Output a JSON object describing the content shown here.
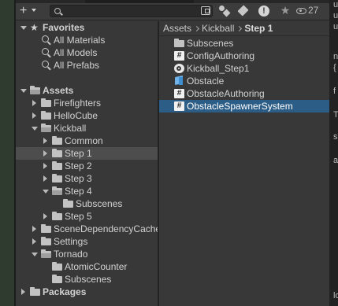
{
  "toolbar": {
    "add_label": "+",
    "hidden_count": "27"
  },
  "right_edge_text": [
    "u",
    "u",
    "u",
    "n",
    "{",
    "f",
    "T",
    "s",
    "a",
    "lo"
  ],
  "tree": {
    "rows": [
      {
        "label": "Favorites",
        "bold": true,
        "arrow": "open",
        "icon": "star",
        "depth": 0,
        "icon_name": "star-icon"
      },
      {
        "label": "All Materials",
        "bold": false,
        "arrow": "none",
        "icon": "search",
        "depth": 1,
        "icon_name": "search-icon"
      },
      {
        "label": "All Models",
        "bold": false,
        "arrow": "none",
        "icon": "search",
        "depth": 1,
        "icon_name": "search-icon"
      },
      {
        "label": "All Prefabs",
        "bold": false,
        "arrow": "none",
        "icon": "search",
        "depth": 1,
        "icon_name": "search-icon"
      },
      {
        "label": "Assets",
        "bold": true,
        "arrow": "open",
        "icon": "folder-open",
        "depth": 0,
        "icon_name": "folder-open-icon"
      },
      {
        "label": "Firefighters",
        "bold": false,
        "arrow": "closed",
        "icon": "folder",
        "depth": 1,
        "icon_name": "folder-icon"
      },
      {
        "label": "HelloCube",
        "bold": false,
        "arrow": "closed",
        "icon": "folder",
        "depth": 1,
        "icon_name": "folder-icon"
      },
      {
        "label": "Kickball",
        "bold": false,
        "arrow": "open",
        "icon": "folder-open",
        "depth": 1,
        "icon_name": "folder-open-icon"
      },
      {
        "label": "Common",
        "bold": false,
        "arrow": "closed",
        "icon": "folder",
        "depth": 2,
        "icon_name": "folder-icon"
      },
      {
        "label": "Step 1",
        "bold": false,
        "arrow": "closed",
        "icon": "folder",
        "depth": 2,
        "icon_name": "folder-icon",
        "selected": true
      },
      {
        "label": "Step 2",
        "bold": false,
        "arrow": "closed",
        "icon": "folder",
        "depth": 2,
        "icon_name": "folder-icon"
      },
      {
        "label": "Step 3",
        "bold": false,
        "arrow": "closed",
        "icon": "folder",
        "depth": 2,
        "icon_name": "folder-icon"
      },
      {
        "label": "Step 4",
        "bold": false,
        "arrow": "open",
        "icon": "folder-open",
        "depth": 2,
        "icon_name": "folder-open-icon"
      },
      {
        "label": "Subscenes",
        "bold": false,
        "arrow": "none",
        "icon": "folder",
        "depth": 3,
        "icon_name": "folder-icon"
      },
      {
        "label": "Step 5",
        "bold": false,
        "arrow": "closed",
        "icon": "folder",
        "depth": 2,
        "icon_name": "folder-icon"
      },
      {
        "label": "SceneDependencyCache",
        "bold": false,
        "arrow": "closed",
        "icon": "folder",
        "depth": 1,
        "icon_name": "folder-icon"
      },
      {
        "label": "Settings",
        "bold": false,
        "arrow": "closed",
        "icon": "folder",
        "depth": 1,
        "icon_name": "folder-icon"
      },
      {
        "label": "Tornado",
        "bold": false,
        "arrow": "open",
        "icon": "folder-open",
        "depth": 1,
        "icon_name": "folder-open-icon"
      },
      {
        "label": "AtomicCounter",
        "bold": false,
        "arrow": "none",
        "icon": "folder",
        "depth": 2,
        "icon_name": "folder-icon"
      },
      {
        "label": "Subscenes",
        "bold": false,
        "arrow": "none",
        "icon": "folder",
        "depth": 2,
        "icon_name": "folder-icon"
      },
      {
        "label": "Packages",
        "bold": true,
        "arrow": "closed",
        "icon": "folder",
        "depth": 0,
        "icon_name": "folder-icon"
      }
    ]
  },
  "breadcrumb": {
    "items": [
      "Assets",
      "Kickball"
    ],
    "current": "Step 1"
  },
  "files": [
    {
      "label": "Subscenes",
      "type": "folder",
      "icon_name": "folder-icon"
    },
    {
      "label": "ConfigAuthoring",
      "type": "script",
      "icon_name": "script-icon"
    },
    {
      "label": "Kickball_Step1",
      "type": "scene",
      "icon_name": "scene-icon"
    },
    {
      "label": "Obstacle",
      "type": "prefab",
      "icon_name": "prefab-icon"
    },
    {
      "label": "ObstacleAuthoring",
      "type": "script",
      "icon_name": "script-icon"
    },
    {
      "label": "ObstacleSpawnerSystem",
      "type": "script",
      "icon_name": "script-icon",
      "selected": true
    }
  ],
  "colors": {
    "selection": "#2c5d87",
    "tree_selected": "#4d4d4d",
    "panel_bg": "#383838"
  }
}
